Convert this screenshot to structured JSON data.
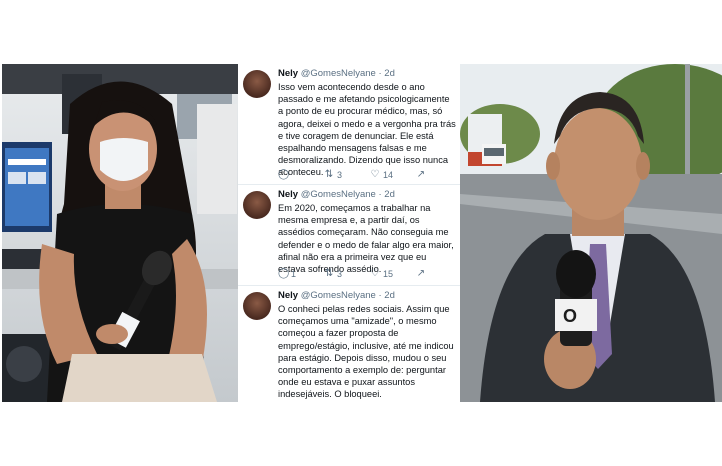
{
  "tweets": [
    {
      "name": "Nely",
      "handle": "@GomesNelyane",
      "time": "· 2d",
      "text": "Isso vem acontecendo desde o ano passado e me afetando psicologicamente a ponto de eu procurar médico, mas, só agora, deixei o medo e a vergonha pra trás e tive coragem de denunciar. Ele está espalhando mensagens falsas e me desmoralizando. Dizendo que isso nunca aconteceu.",
      "replies": "",
      "retweets": "3",
      "likes": "14"
    },
    {
      "name": "Nely",
      "handle": "@GomesNelyane",
      "time": "· 2d",
      "text": "Em 2020, começamos a trabalhar na mesma empresa e, a partir daí, os assédios começaram. Não conseguia me defender e o medo de falar algo era maior, afinal não era a primeira vez que eu estava sofrendo assédio.",
      "replies": "1",
      "retweets": "3",
      "likes": "15"
    },
    {
      "name": "Nely",
      "handle": "@GomesNelyane",
      "time": "· 2d",
      "text": "O conheci pelas redes sociais. Assim que começamos uma \"amizade\", o mesmo começou a fazer proposta de emprego/estágio, inclusive, até me indicou para estágio. Depois disso, mudou o seu comportamento a exemplo de: perguntar onde eu estava e puxar assuntos indesejáveis. O bloqueei."
    }
  ],
  "right_photo": {
    "mic_logo": "O"
  },
  "left_photo": {
    "mic_logo": ""
  }
}
